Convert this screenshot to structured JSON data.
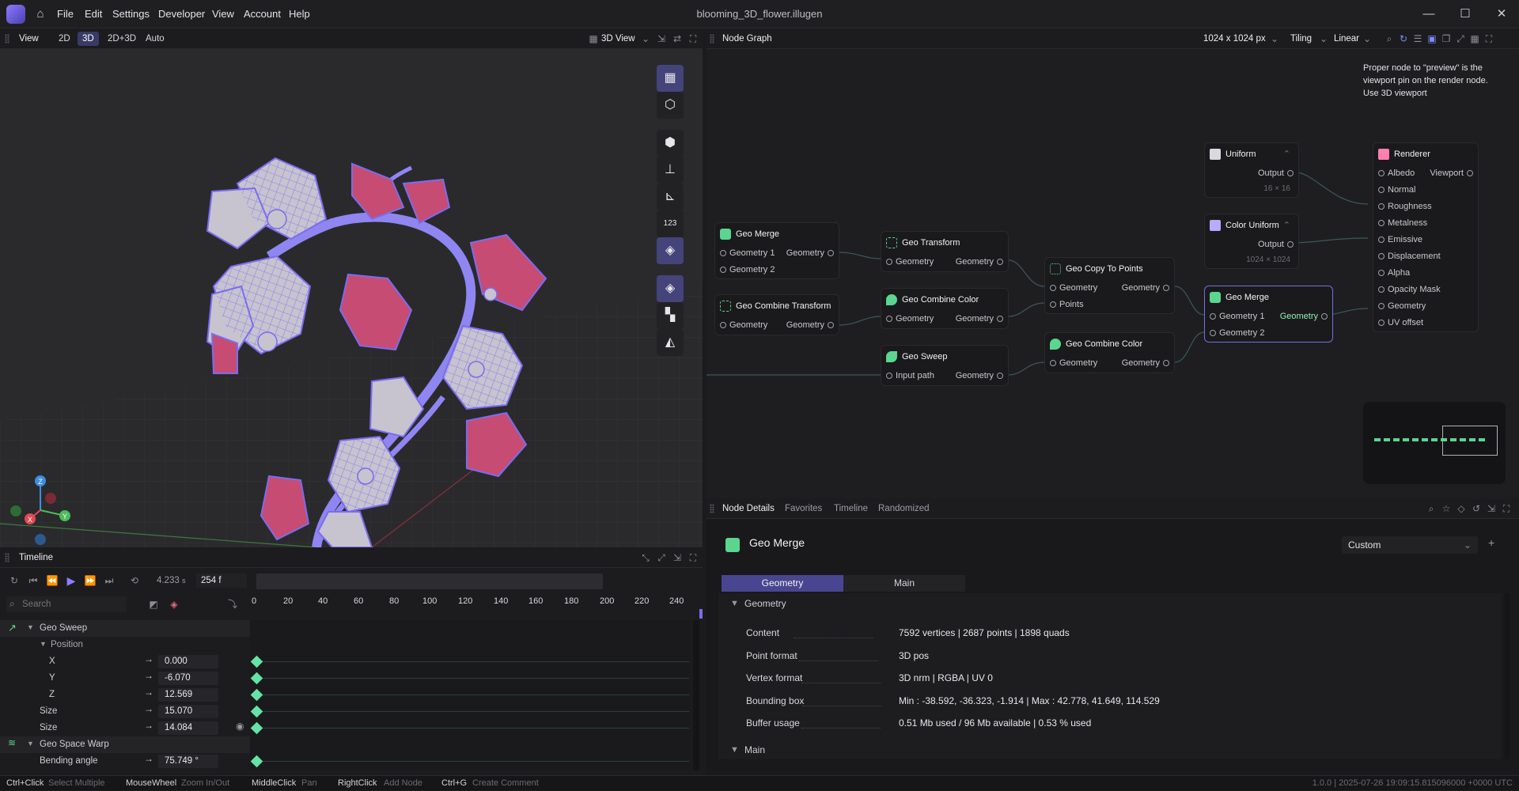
{
  "app": {
    "title": "blooming_3D_flower.illugen",
    "menu": [
      "File",
      "Edit",
      "Settings",
      "Developer",
      "View",
      "Account",
      "Help"
    ]
  },
  "viewport": {
    "tab": "View",
    "modes": [
      "2D",
      "3D",
      "2D+3D",
      "Auto"
    ],
    "active_mode": "3D",
    "view_select": "3D View",
    "axes": {
      "x": "X",
      "y": "Y",
      "z": "Z"
    },
    "tool_counter": "123"
  },
  "graph": {
    "tab": "Node Graph",
    "resolution": "1024 x 1024 px",
    "tiling": "Tiling",
    "filter": "Linear",
    "hint": "Proper node to \"preview\" is the viewport pin on the render node. Use 3D viewport",
    "nodes": {
      "geo_merge_a": {
        "title": "Geo Merge",
        "in1": "Geometry 1",
        "in2": "Geometry 2",
        "out": "Geometry"
      },
      "geo_combine_transform": {
        "title": "Geo Combine Transform",
        "in": "Geometry",
        "out": "Geometry"
      },
      "geo_transform": {
        "title": "Geo Transform",
        "in": "Geometry",
        "out": "Geometry"
      },
      "geo_combine_color_a": {
        "title": "Geo Combine Color",
        "in": "Geometry",
        "out": "Geometry"
      },
      "geo_sweep": {
        "title": "Geo Sweep",
        "in": "Input path",
        "out": "Geometry"
      },
      "geo_copy_to_points": {
        "title": "Geo Copy To Points",
        "in1": "Geometry",
        "in2": "Points",
        "out": "Geometry"
      },
      "geo_combine_color_b": {
        "title": "Geo Combine Color",
        "in": "Geometry",
        "out": "Geometry"
      },
      "uniform": {
        "title": "Uniform",
        "out": "Output",
        "size": "16 × 16"
      },
      "color_uniform": {
        "title": "Color Uniform",
        "out": "Output",
        "size": "1024 × 1024"
      },
      "geo_merge_b": {
        "title": "Geo Merge",
        "in1": "Geometry 1",
        "in2": "Geometry 2",
        "out": "Geometry"
      },
      "renderer": {
        "title": "Renderer",
        "inputs": [
          "Albedo",
          "Normal",
          "Roughness",
          "Metalness",
          "Emissive",
          "Displacement",
          "Alpha",
          "Opacity Mask",
          "Geometry",
          "UV offset"
        ],
        "out": "Viewport"
      }
    }
  },
  "details": {
    "tabs": [
      "Node Details",
      "Favorites",
      "Timeline",
      "Randomized"
    ],
    "node_title": "Geo Merge",
    "preset": "Custom",
    "subtabs": [
      "Geometry",
      "Main"
    ],
    "section_geometry": "Geometry",
    "section_main": "Main",
    "rows": [
      {
        "label": "Content",
        "value": "7592 vertices  |  2687 points  |  1898 quads"
      },
      {
        "label": "Point format",
        "value": "3D pos"
      },
      {
        "label": "Vertex format",
        "value": "3D nrm  |  RGBA  |  UV 0"
      },
      {
        "label": "Bounding box",
        "value": "Min : -38.592, -36.323, -1.914  |  Max : 42.778, 41.649, 114.529"
      },
      {
        "label": "Buffer usage",
        "value": "0.51 Mb used / 96 Mb available  |  0.53 % used"
      }
    ]
  },
  "timeline": {
    "tab": "Timeline",
    "time": "4.233",
    "time_unit": "s",
    "frame": "254 f",
    "search_placeholder": "Search",
    "ruler": [
      "0",
      "20",
      "40",
      "60",
      "80",
      "100",
      "120",
      "140",
      "160",
      "180",
      "200",
      "220",
      "240"
    ],
    "tracks": [
      {
        "label": "Geo Sweep",
        "kind": "group"
      },
      {
        "label": "Position",
        "kind": "sub"
      },
      {
        "label": "X",
        "value": "0.000"
      },
      {
        "label": "Y",
        "value": "-6.070"
      },
      {
        "label": "Z",
        "value": "12.569"
      },
      {
        "label": "Size",
        "value": "15.070"
      },
      {
        "label": "Size",
        "value": "14.084"
      },
      {
        "label": "Geo Space Warp",
        "kind": "group"
      },
      {
        "label": "Bending angle",
        "value": "75.749 °"
      }
    ]
  },
  "status": {
    "shortcuts": [
      {
        "key": "Ctrl+Click",
        "desc": "Select Multiple"
      },
      {
        "key": "MouseWheel",
        "desc": "Zoom In/Out"
      },
      {
        "key": "MiddleClick",
        "desc": "Pan"
      },
      {
        "key": "RightClick",
        "desc": "Add Node"
      },
      {
        "key": "Ctrl+G",
        "desc": "Create Comment"
      }
    ],
    "version": "1.0.0  |  2025-07-26 19:09:15.815096000 +0000 UTC"
  }
}
